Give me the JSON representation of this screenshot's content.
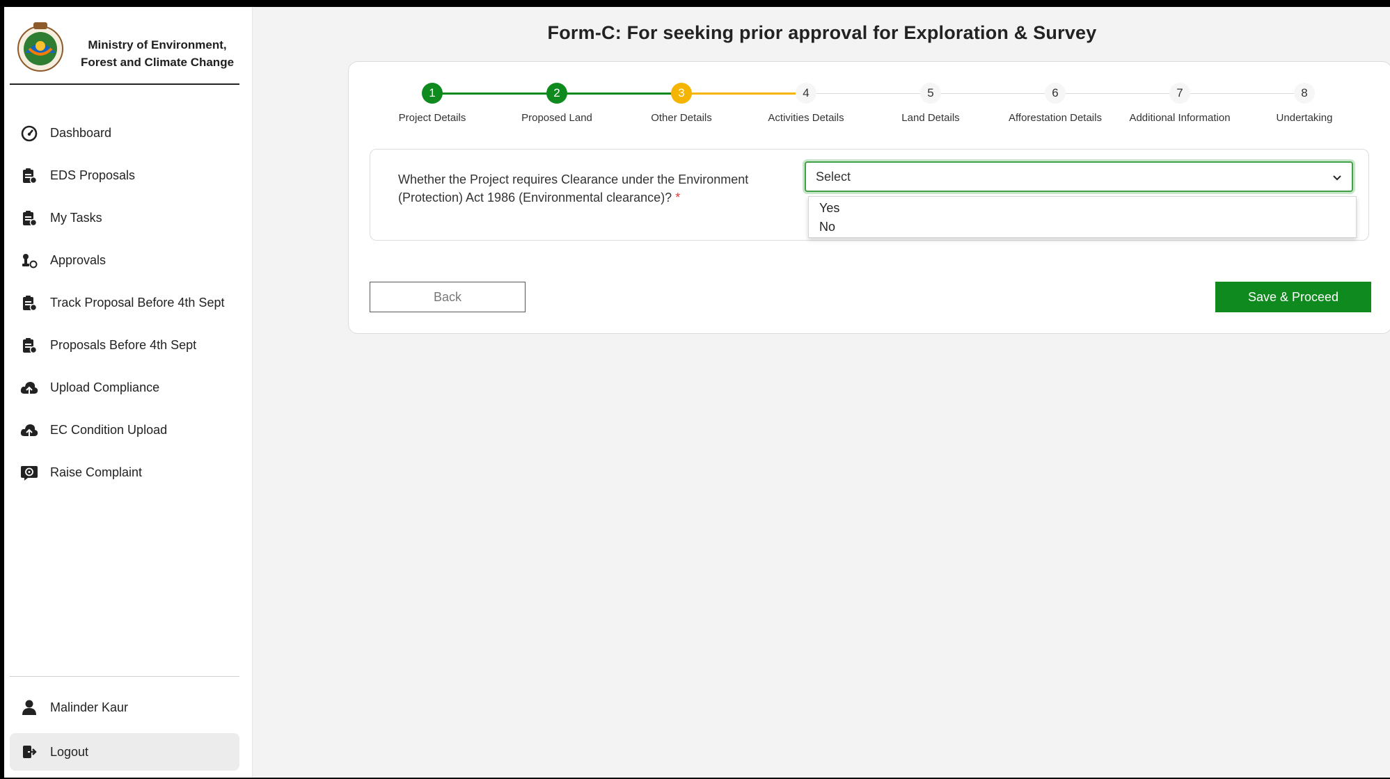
{
  "sidebar": {
    "brand": "Ministry of Environment, Forest and Climate Change",
    "items": [
      {
        "label": "Dashboard",
        "icon": "gauge-icon"
      },
      {
        "label": "EDS Proposals",
        "icon": "clipboard-icon"
      },
      {
        "label": "My Tasks",
        "icon": "clipboard-icon"
      },
      {
        "label": "Approvals",
        "icon": "stamp-icon"
      },
      {
        "label": "Track Proposal Before 4th Sept",
        "icon": "clipboard-icon"
      },
      {
        "label": "Proposals Before 4th Sept",
        "icon": "clipboard-icon"
      },
      {
        "label": "Upload Compliance",
        "icon": "cloud-upload-icon"
      },
      {
        "label": "EC Condition Upload",
        "icon": "cloud-upload-icon"
      },
      {
        "label": "Raise Complaint",
        "icon": "complaint-icon"
      }
    ],
    "user_name": "Malinder Kaur",
    "logout_label": "Logout"
  },
  "main": {
    "title": "Form-C: For seeking prior approval for Exploration & Survey",
    "steps": [
      {
        "num": "1",
        "label": "Project Details",
        "state": "done"
      },
      {
        "num": "2",
        "label": "Proposed Land",
        "state": "done"
      },
      {
        "num": "3",
        "label": "Other Details",
        "state": "current"
      },
      {
        "num": "4",
        "label": "Activities Details",
        "state": "pending"
      },
      {
        "num": "5",
        "label": "Land Details",
        "state": "pending"
      },
      {
        "num": "6",
        "label": "Afforestation Details",
        "state": "pending"
      },
      {
        "num": "7",
        "label": "Additional Information",
        "state": "pending"
      },
      {
        "num": "8",
        "label": "Undertaking",
        "state": "pending"
      }
    ],
    "question": "Whether the Project requires Clearance under the Environment (Protection) Act 1986 (Environmental clearance)?",
    "required_mark": "*",
    "select_value": "Select",
    "options": [
      "Yes",
      "No"
    ],
    "back_label": "Back",
    "save_label": "Save & Proceed"
  },
  "colors": {
    "done": "#0f8a1e",
    "current": "#f4b400",
    "pending": "#d9d9d9",
    "primary_button": "#0f8a1e"
  }
}
